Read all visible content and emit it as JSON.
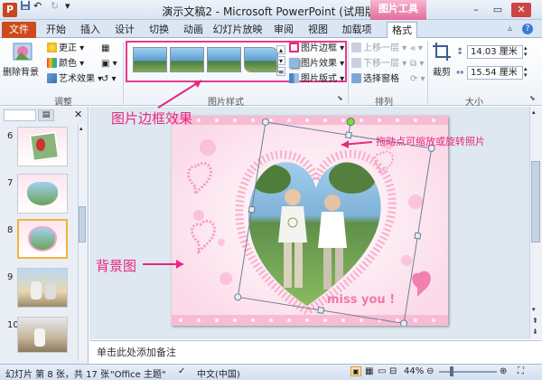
{
  "titlebar": {
    "title": "演示文稿2 - Microsoft PowerPoint (试用版)",
    "context_tab": "图片工具",
    "quick_access": [
      "save-icon",
      "undo-icon",
      "redo-icon",
      "customize-icon"
    ]
  },
  "tabs": [
    "文件",
    "开始",
    "插入",
    "设计",
    "切换",
    "动画",
    "幻灯片放映",
    "审阅",
    "视图",
    "加载项",
    "格式"
  ],
  "ribbon": {
    "adjust": {
      "remove_bg": "删除背景",
      "corrections": "更正",
      "color": "颜色",
      "art_effects": "艺术效果",
      "label": "调整"
    },
    "picture_styles": {
      "border": "图片边框",
      "effects": "图片效果",
      "layout": "图片版式",
      "label": "图片样式"
    },
    "arrange": {
      "bring_forward": "上移一层",
      "send_backward": "下移一层",
      "selection_pane": "选择窗格",
      "label": "排列"
    },
    "size": {
      "crop": "裁剪",
      "height": "14.03 厘米",
      "width": "15.54 厘米",
      "label": "大小"
    }
  },
  "slides": [
    {
      "num": "6"
    },
    {
      "num": "7"
    },
    {
      "num": "8"
    },
    {
      "num": "9"
    },
    {
      "num": "10"
    }
  ],
  "slide": {
    "caption": "miss you !"
  },
  "annotations": {
    "border_effect": "图片边框效果",
    "drag_handle": "拖动点可缩放或旋转照片",
    "background": "背景图"
  },
  "notes": {
    "placeholder": "单击此处添加备注"
  },
  "status": {
    "slide_info": "幻灯片 第 8 张，共 17 张",
    "theme": "\"Office 主题\"",
    "language": "中文(中国)",
    "zoom": "44%"
  },
  "colors": {
    "accent_pink": "#e6287f",
    "file_tab": "#cd4a1c",
    "context_tab": "#e36c9c"
  }
}
